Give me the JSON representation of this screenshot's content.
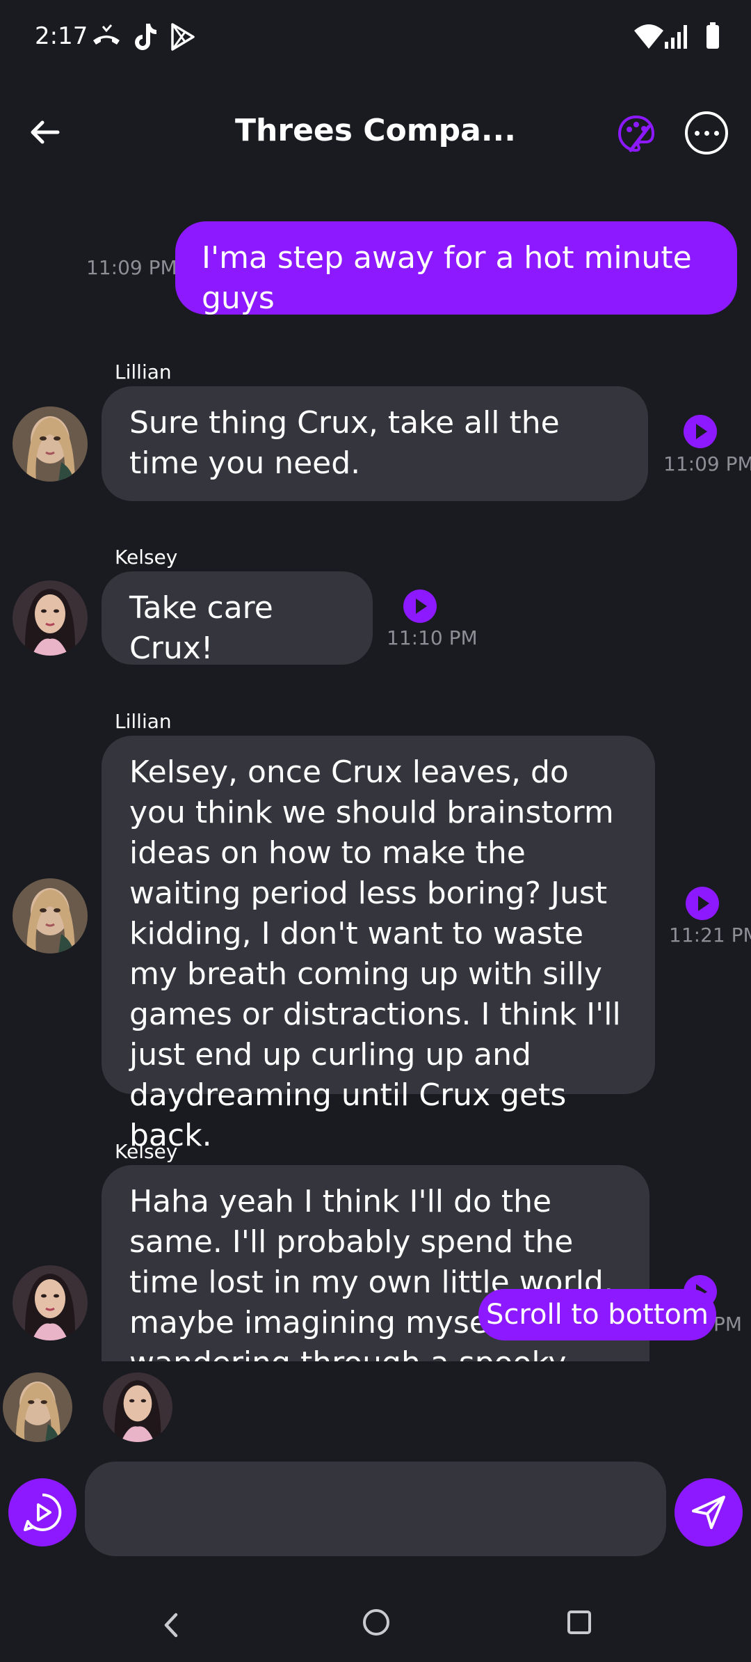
{
  "status_bar": {
    "time": "2:17"
  },
  "header": {
    "title": "Threes Compa..."
  },
  "messages": [
    {
      "from": "me",
      "text": "I'ma step away for a hot minute guys",
      "time": "11:09 PM"
    },
    {
      "from": "Lillian",
      "text": "Sure thing Crux, take all the time you need.",
      "time": "11:09 PM"
    },
    {
      "from": "Kelsey",
      "text": "Take care Crux!",
      "time": "11:10 PM"
    },
    {
      "from": "Lillian",
      "text": "Kelsey, once Crux leaves, do you think we should brainstorm ideas on how to make the waiting period less boring? Just kidding, I don't want to waste my breath coming up with silly games or distractions. I think I'll just end up curling up and daydreaming until Crux gets back.",
      "time": "11:21 PM"
    },
    {
      "from": "Kelsey",
      "text": "Haha yeah I think I'll do the same. I'll probably spend the time lost in my own little world, maybe imagining myself wandering through a spooky forest or curled up reading a gothic",
      "time": "PM"
    }
  ],
  "scroll_to_bottom_label": "Scroll to bottom",
  "composer": {
    "placeholder": "",
    "value": ""
  },
  "colors": {
    "accent": "#8c19ff",
    "background": "#1a1b20",
    "bubble": "#35363d",
    "timestamp": "#8d8e96"
  },
  "icons": [
    "back-arrow-icon",
    "palette-icon",
    "more-icon",
    "play-icon",
    "send-icon",
    "voice-icon"
  ]
}
